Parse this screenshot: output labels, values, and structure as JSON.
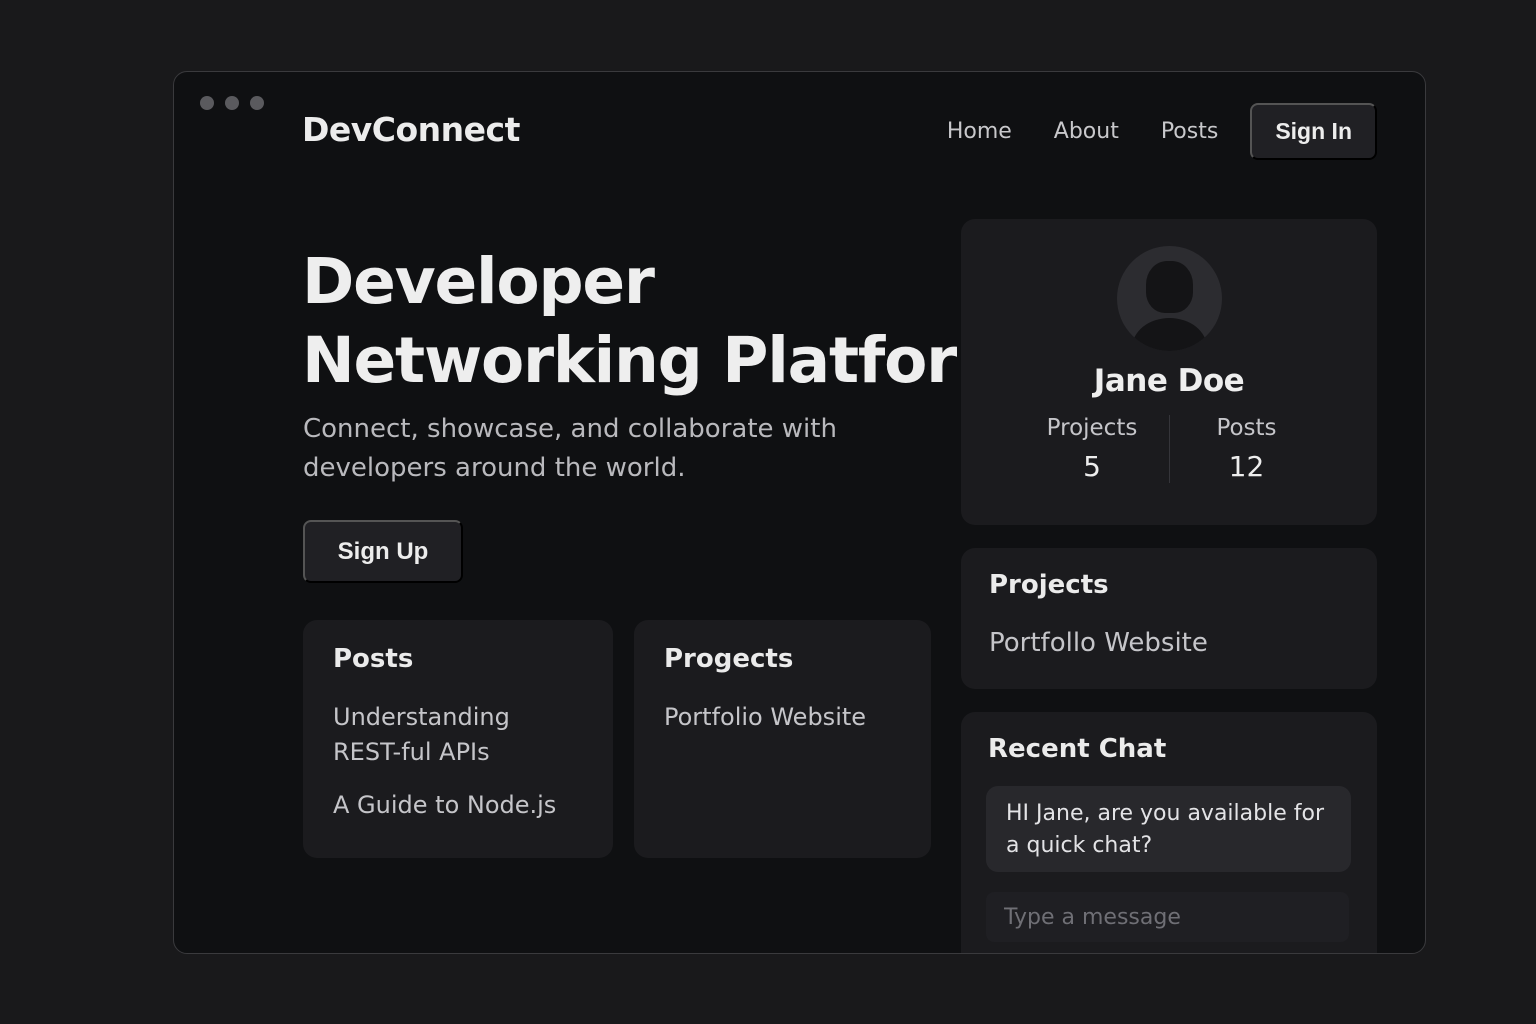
{
  "brand": "DevConnect",
  "nav": {
    "links": [
      "Home",
      "About",
      "Posts"
    ],
    "signin_label": "Sign In"
  },
  "hero": {
    "title_line1": "Developer",
    "title_line2": "Networking Platform",
    "subtitle": "Connect, showcase, and collaborate with developers around the world.",
    "signup_label": "Sign Up"
  },
  "posts_card": {
    "title": "Posts",
    "items": [
      "Understanding REST-ful APIs",
      "A Guide to Node.js"
    ]
  },
  "progects_card": {
    "title": "Progects",
    "items": [
      "Portfolio Website"
    ]
  },
  "profile": {
    "name": "Jane Doe",
    "stats": [
      {
        "label": "Projects",
        "value": "5"
      },
      {
        "label": "Posts",
        "value": "12"
      }
    ]
  },
  "projects_card": {
    "title": "Projects",
    "items": [
      "Portfollo Website"
    ]
  },
  "chat": {
    "title": "Recent Chat",
    "message": "HI Jane, are you available for a quick chat?",
    "input_placeholder": "Type a message",
    "input_value": ""
  },
  "colors": {
    "page_bg": "#19191b",
    "window_bg": "#0f1012",
    "card_bg": "#1b1b1e",
    "button_bg": "#202024"
  }
}
